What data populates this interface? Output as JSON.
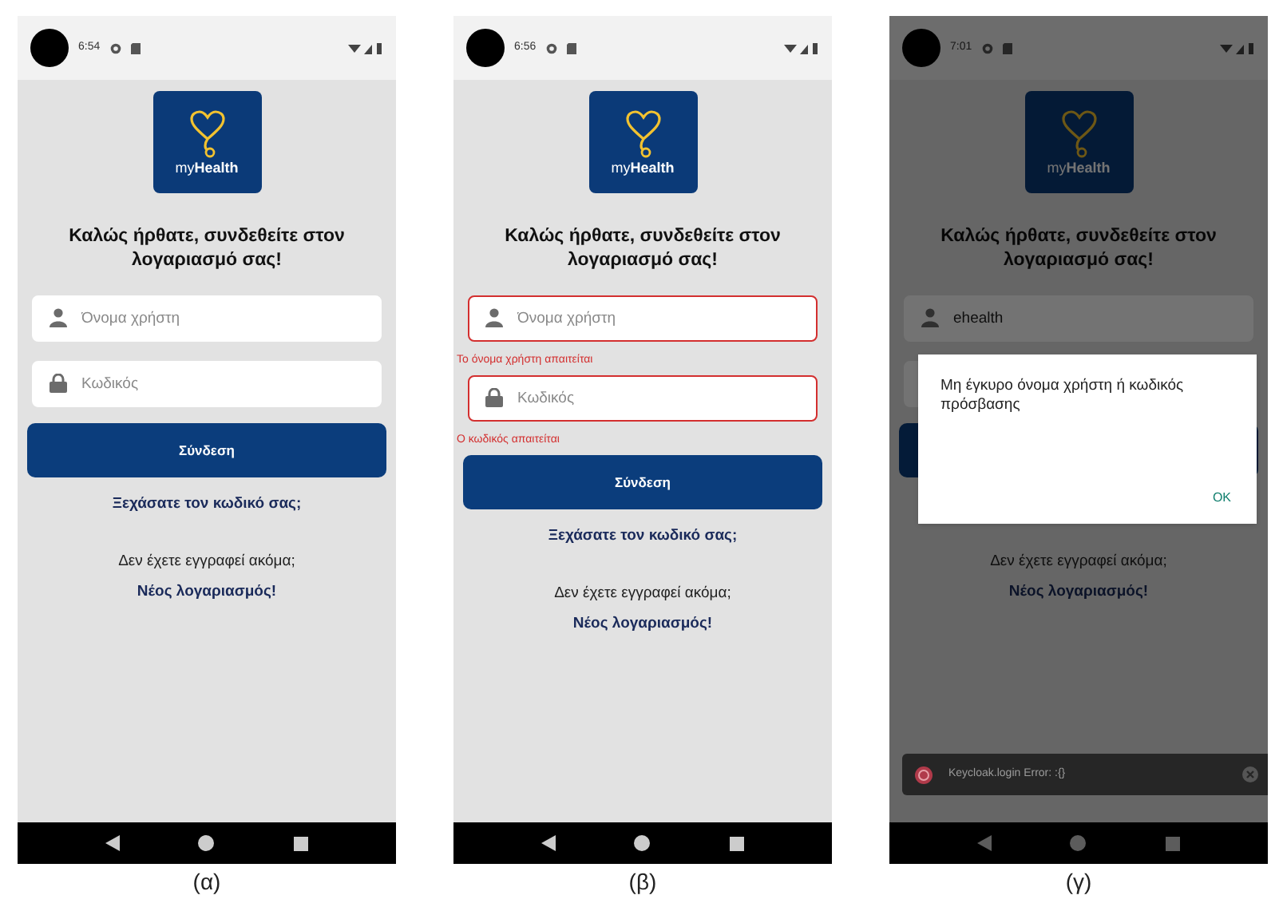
{
  "phones": [
    {
      "caption": "(α)",
      "time": "6:54",
      "logo_text": "my**Health**",
      "title": "Καλώς ήρθατε, συνδεθείτε στον λογαριασμό σας!",
      "fields": [
        {
          "kind": "username",
          "placeholder": "Όνομα χρήστη"
        },
        {
          "kind": "password",
          "placeholder": "Κωδικός"
        }
      ],
      "login_button": "Σύνδεση",
      "forgot_link": "Ξεχάσατε τον κωδικό σας;",
      "register_prompt": "Δεν έχετε εγγραφεί ακόμα;",
      "register_link": "Νέος λογαριασμός!",
      "dimmed": false
    },
    {
      "caption": "(β)",
      "time": "6:56",
      "logo_text": "my**Health**",
      "title": "Καλώς ήρθατε, συνδεθείτε στον λογαριασμό σας!",
      "fields": [
        {
          "kind": "username",
          "placeholder": "Όνομα χρήστη",
          "error": "Το όνομα χρήστη απαιτείται"
        },
        {
          "kind": "password",
          "placeholder": "Κωδικός",
          "error": "Ο κωδικός απαιτείται"
        }
      ],
      "login_button": "Σύνδεση",
      "forgot_link": "Ξεχάσατε τον κωδικό σας;",
      "register_prompt": "Δεν έχετε εγγραφεί ακόμα;",
      "register_link": "Νέος λογαριασμός!",
      "dimmed": false
    },
    {
      "caption": "(γ)",
      "time": "7:01",
      "logo_text": "my**Health**",
      "title": "Καλώς ήρθατε, συνδεθείτε στον λογαριασμό σας!",
      "fields": [
        {
          "kind": "username",
          "value": "ehealth"
        },
        {
          "kind": "password"
        }
      ],
      "register_prompt": "Δεν έχετε εγγραφεί ακόμα;",
      "register_link": "Νέος λογαριασμός!",
      "dimmed": true,
      "dialog": {
        "message": "Μη έγκυρο όνομα χρήστη ή κωδικός πρόσβασης",
        "button": "OK"
      },
      "toast": {
        "message": "Keycloak.login Error: :{}"
      }
    }
  ]
}
